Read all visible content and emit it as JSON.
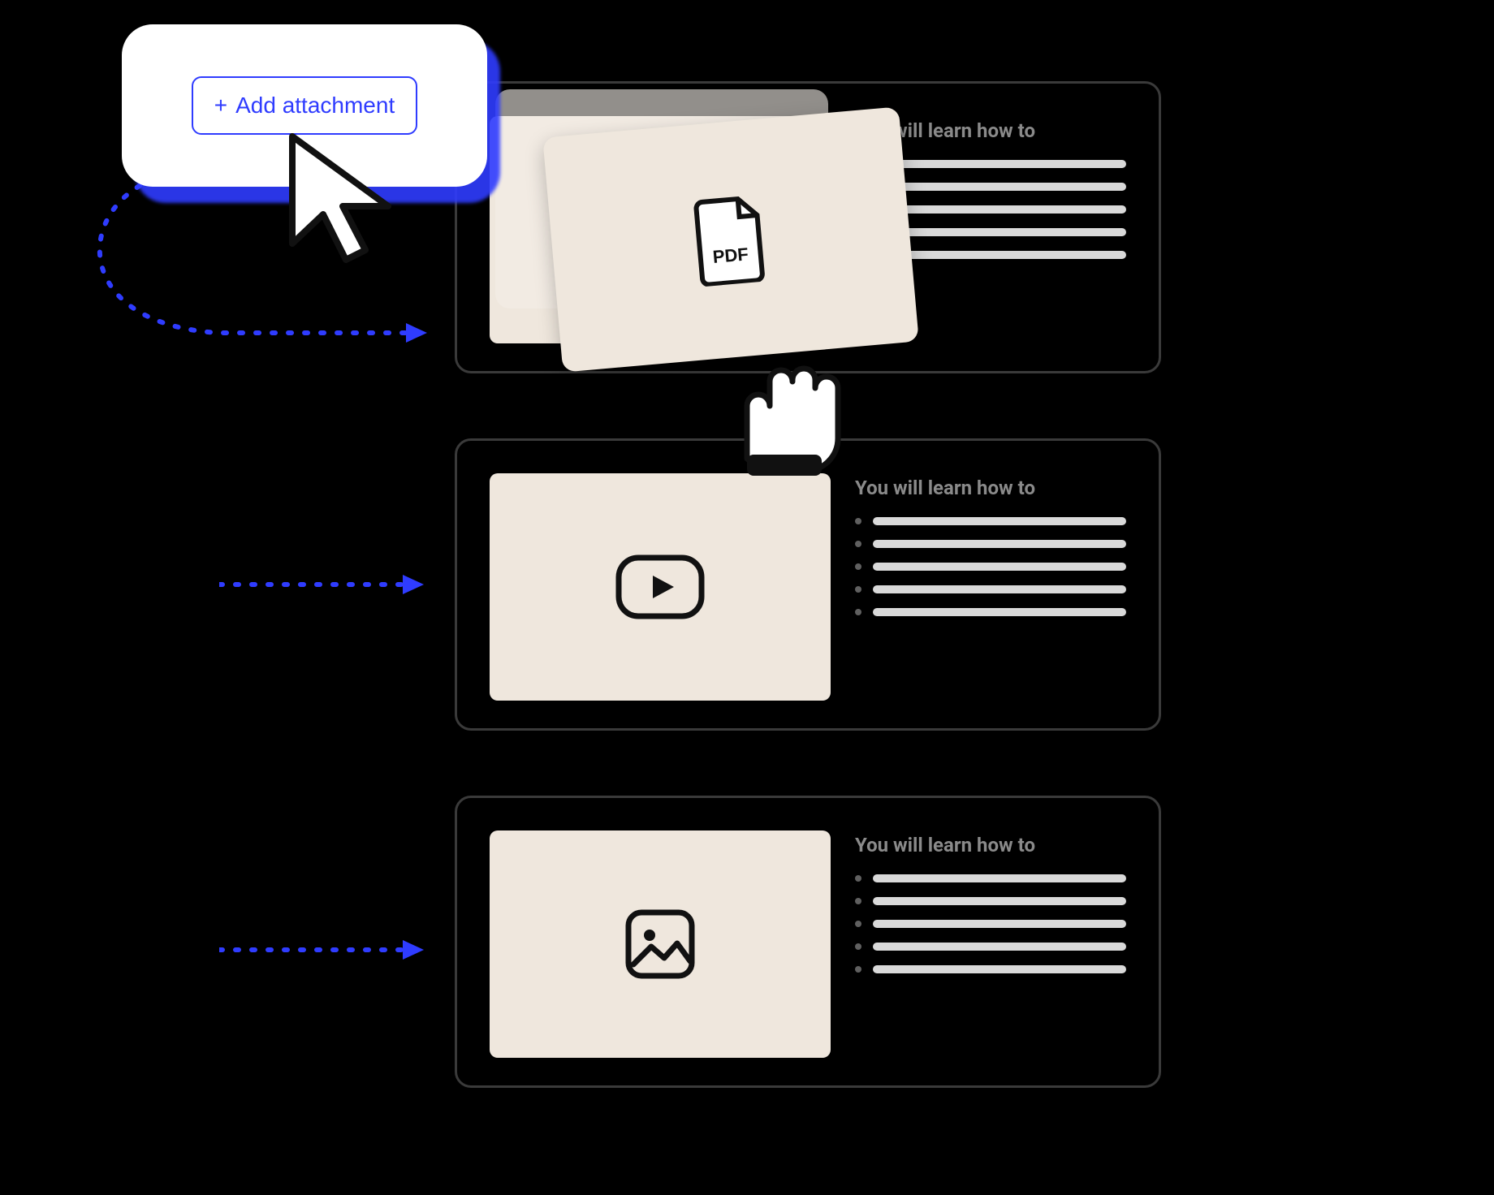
{
  "badge": {
    "button_label": "Add attachment",
    "plus_glyph": "+"
  },
  "rows": [
    {
      "heading": "You will learn how to",
      "icon": "pdf",
      "pdf_label": "PDF"
    },
    {
      "heading": "You will learn how to",
      "icon": "video"
    },
    {
      "heading": "You will learn how to",
      "icon": "image"
    }
  ],
  "colors": {
    "accent": "#2f3cff",
    "tile": "#efe7dd",
    "outline": "#3a3a3a",
    "bar": "#d9d9d9",
    "dot": "#606060",
    "heading": "#8a8a8a"
  }
}
